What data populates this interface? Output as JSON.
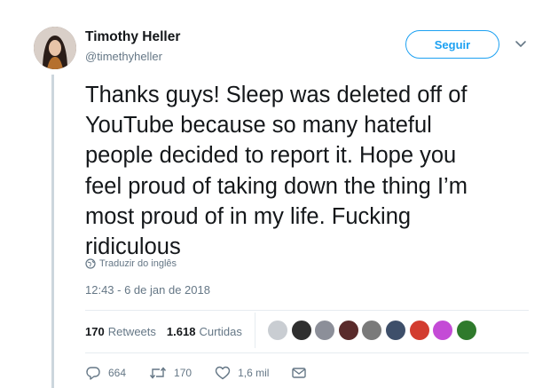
{
  "author": {
    "name": "Timothy Heller",
    "handle": "@timethyheller"
  },
  "follow_button": "Seguir",
  "tweet_text": "Thanks guys! Sleep was deleted off of\nYouTube because so many hateful\npeople decided to report it. Hope you\nfeel proud of taking down the thing I’m\nmost proud of in my life. Fucking\nridiculous",
  "translate_label": "Traduzir do inglês",
  "timestamp": "12:43 - 6 de jan de 2018",
  "stats": {
    "retweets_count": "170",
    "retweets_label": "Retweets",
    "likes_count": "1.618",
    "likes_label": "Curtidas"
  },
  "likers": [
    {
      "color": "#c9cdd2"
    },
    {
      "color": "#2f2f2f"
    },
    {
      "color": "#8c8f99"
    },
    {
      "color": "#5a2b2b"
    },
    {
      "color": "#7a7a7a"
    },
    {
      "color": "#3e4f6a"
    },
    {
      "color": "#d23c2f"
    },
    {
      "color": "#c44bd6"
    },
    {
      "color": "#2f7a2c"
    }
  ],
  "actions": {
    "replies": "664",
    "retweets": "170",
    "likes": "1,6 mil"
  },
  "colors": {
    "accent": "#1da1f2",
    "muted": "#657786"
  }
}
